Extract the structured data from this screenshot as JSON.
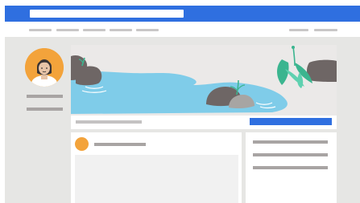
{
  "header": {
    "search_bar": {
      "value": "",
      "placeholder": ""
    },
    "colors": {
      "primary": "#2f6fe0"
    }
  },
  "navigation": {
    "left_items": [
      "",
      "",
      "",
      "",
      ""
    ],
    "right_items": [
      "",
      ""
    ]
  },
  "profile": {
    "avatar": {
      "icon": "user-avatar-icon",
      "background": "#f3a33b"
    },
    "details": [
      "",
      ""
    ]
  },
  "cover": {
    "illustration": "lake-with-rocks-and-plants",
    "action_button": {
      "label": ""
    },
    "caption": ""
  },
  "post": {
    "author_avatar": {
      "background": "#f3a33b"
    },
    "author_name": "",
    "content": ""
  },
  "side_panel": {
    "items": [
      "",
      "",
      ""
    ]
  }
}
